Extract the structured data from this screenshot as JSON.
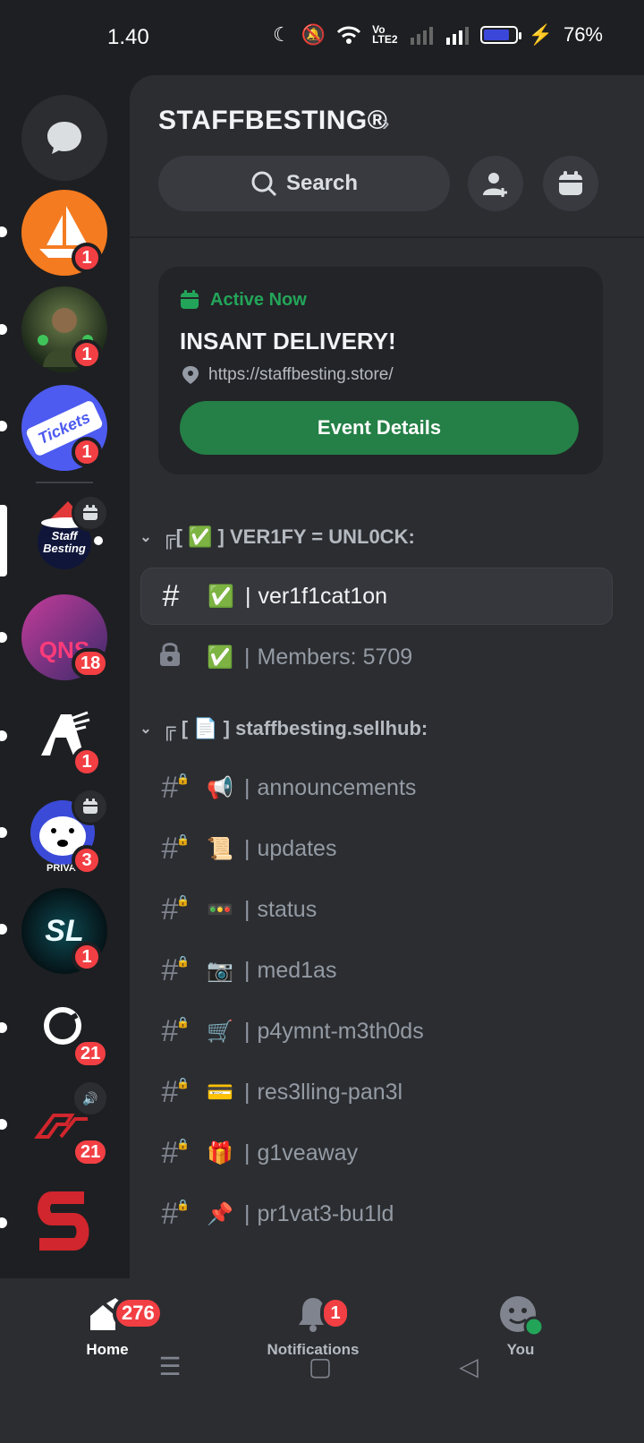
{
  "status": {
    "time": "1.40",
    "battery": "76%"
  },
  "rail": {
    "servers": [
      {
        "name": "sailboat-server",
        "badge": "1",
        "color": "#f47b20"
      },
      {
        "name": "warrior-server",
        "badge": "1",
        "color": "#2f4a2f"
      },
      {
        "name": "tickets-server",
        "badge": "1",
        "color": "#4d5bf0",
        "text": "Tickets"
      },
      {
        "name": "staffbesting-server",
        "text": "Staff Besting",
        "selected": true,
        "event": true
      },
      {
        "name": "qnse-server",
        "badge": "18",
        "color": "#8a2e6f",
        "text": "QNS"
      },
      {
        "name": "a-server",
        "badge": "1"
      },
      {
        "name": "bear-server",
        "badge": "3",
        "event": true,
        "text": "PRIVAC"
      },
      {
        "name": "sl-server",
        "badge": "1",
        "text": "SL"
      },
      {
        "name": "cr-server",
        "badge": "21"
      },
      {
        "name": "rx-server",
        "badge": "21",
        "voice": true
      },
      {
        "name": "s-server"
      }
    ]
  },
  "server": {
    "title": "STAFFBESTING®",
    "search_label": "Search"
  },
  "event": {
    "status": "Active Now",
    "title": "INSANT DELIVERY!",
    "url": "https://staffbesting.store/",
    "button": "Event Details"
  },
  "categories": [
    {
      "label": "╔[ ✅ ] VER1FY = UNL0CK:"
    },
    {
      "label": "╔ [ 📄 ] staffbesting.sellhub:"
    }
  ],
  "channels": [
    {
      "emoji": "✅",
      "name": "ver1f1cat1on",
      "selected": true,
      "type": "text"
    },
    {
      "emoji": "✅",
      "name": "Members: 5709",
      "type": "locked"
    },
    {
      "emoji": "📢",
      "name": "announcements",
      "type": "text-locked"
    },
    {
      "emoji": "📜",
      "name": "updates",
      "type": "text-locked"
    },
    {
      "emoji": "🚥",
      "name": "status",
      "type": "text-locked"
    },
    {
      "emoji": "📷",
      "name": "med1as",
      "type": "text-locked"
    },
    {
      "emoji": "🛒",
      "name": "p4ymnt-m3th0ds",
      "type": "text-locked"
    },
    {
      "emoji": "💳",
      "name": "res3lling-pan3l",
      "type": "text-locked"
    },
    {
      "emoji": "🎁",
      "name": "g1veaway",
      "type": "text-locked"
    },
    {
      "emoji": "📌",
      "name": "pr1vat3-bu1ld",
      "type": "text-locked"
    }
  ],
  "tabs": {
    "home": {
      "label": "Home",
      "badge": "276"
    },
    "notifications": {
      "label": "Notifications",
      "badge": "1"
    },
    "you": {
      "label": "You"
    }
  }
}
